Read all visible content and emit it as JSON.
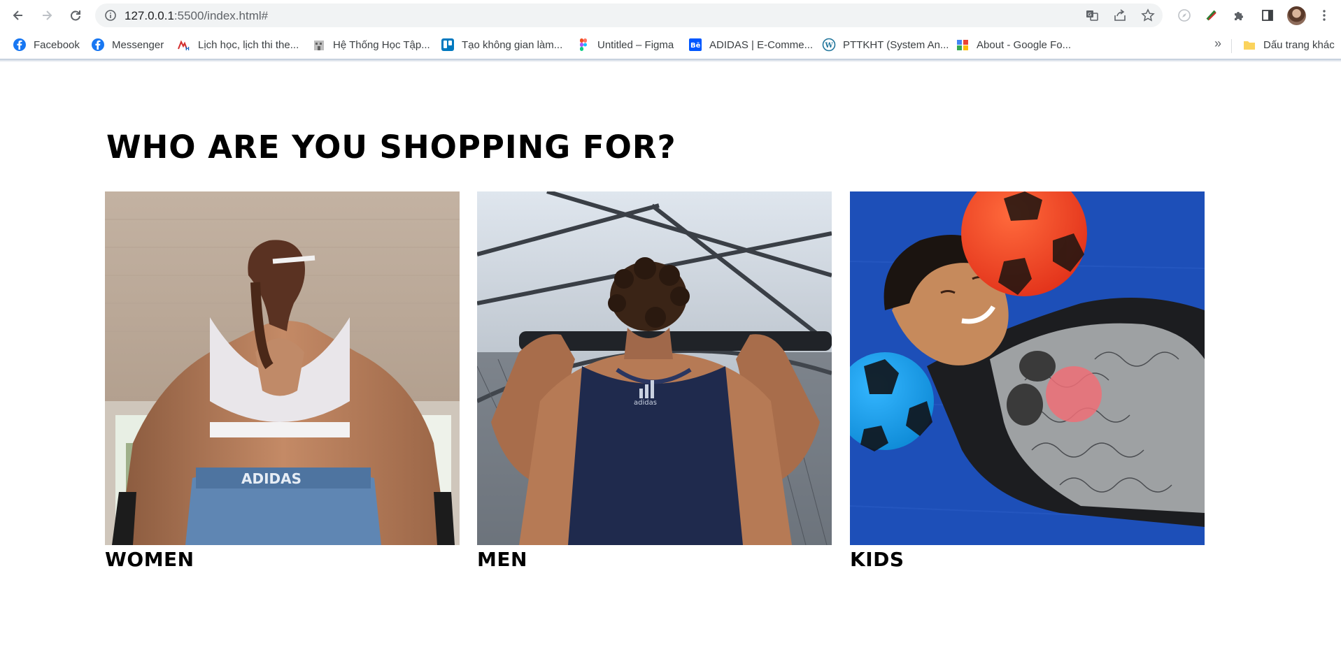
{
  "browser": {
    "url_host": "127.0.0.1",
    "url_rest": ":5500/index.html#",
    "toolbar_icons": [
      "back-icon",
      "forward-icon",
      "reload-icon",
      "site-info-icon",
      "translate-icon",
      "share-icon",
      "star-icon",
      "extension-compass-icon",
      "extension-color-icon",
      "puzzle-icon",
      "side-panel-icon",
      "profile-avatar",
      "menu-icon"
    ]
  },
  "bookmarks": {
    "items": [
      {
        "label": "Facebook",
        "icon": "facebook-icon",
        "color": "#1877f2"
      },
      {
        "label": "Messenger",
        "icon": "facebook-icon",
        "color": "#1877f2"
      },
      {
        "label": "Lịch học, lịch thi the...",
        "icon": "school-logo-icon",
        "color": "#d32f2f"
      },
      {
        "label": "Hệ Thống Học Tập...",
        "icon": "building-icon",
        "color": "#9e9e9e"
      },
      {
        "label": "Tạo không gian làm...",
        "icon": "trello-icon",
        "color": "#0079bf"
      },
      {
        "label": "Untitled – Figma",
        "icon": "figma-icon",
        "color": "#f24e1e"
      },
      {
        "label": "ADIDAS | E-Comme...",
        "icon": "behance-icon",
        "color": "#0057ff"
      },
      {
        "label": "PTTKHT (System An...",
        "icon": "wordpress-icon",
        "color": "#21759b"
      },
      {
        "label": "About - Google Fo...",
        "icon": "google-forms-icon",
        "color": "#ea4335"
      }
    ],
    "more_label": "»",
    "other_folder_label": "Dấu trang khác"
  },
  "page": {
    "title": "WHO ARE YOU SHOPPING FOR?",
    "categories": [
      {
        "label": "WOMEN"
      },
      {
        "label": "MEN"
      },
      {
        "label": "KIDS"
      }
    ]
  },
  "colors": {
    "omnibox_bg": "#f1f3f4",
    "text": "#000000",
    "kids_blue": "#1d4fb8",
    "ball_red": "#ff4a1c",
    "ball_blue": "#17a4f0",
    "men_tank": "#1f2a4d"
  }
}
